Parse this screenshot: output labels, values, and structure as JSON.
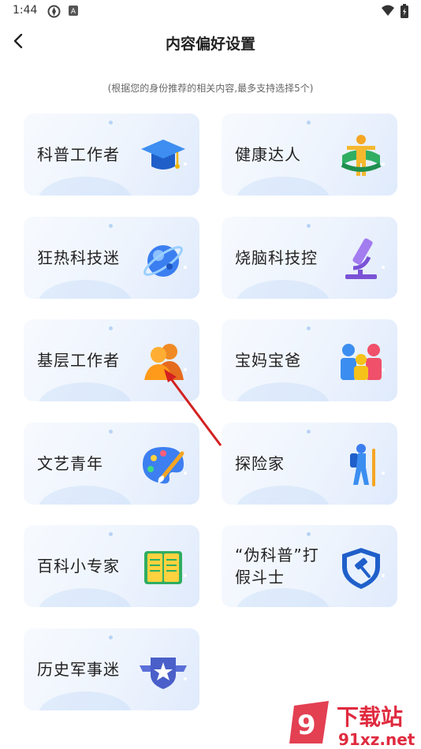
{
  "status_bar": {
    "time": "1:44"
  },
  "header": {
    "title": "内容偏好设置"
  },
  "subtitle": "(根据您的身份推荐的相关内容,最多支持选择5个)",
  "cards": [
    {
      "label": "科普工作者",
      "icon": "graduation-cap-icon"
    },
    {
      "label": "健康达人",
      "icon": "fitness-person-icon"
    },
    {
      "label": "狂热科技迷",
      "icon": "planet-icon"
    },
    {
      "label": "烧脑科技控",
      "icon": "microscope-icon"
    },
    {
      "label": "基层工作者",
      "icon": "people-icon"
    },
    {
      "label": "宝妈宝爸",
      "icon": "family-icon"
    },
    {
      "label": "文艺青年",
      "icon": "palette-icon"
    },
    {
      "label": "探险家",
      "icon": "hiker-icon"
    },
    {
      "label": "百科小专家",
      "icon": "book-icon"
    },
    {
      "label": "“伪科普”打假斗士",
      "icon": "shield-hammer-icon"
    },
    {
      "label": "历史军事迷",
      "icon": "military-badge-icon"
    }
  ],
  "watermark": {
    "brand": "下载站",
    "url": "91xz.net"
  }
}
